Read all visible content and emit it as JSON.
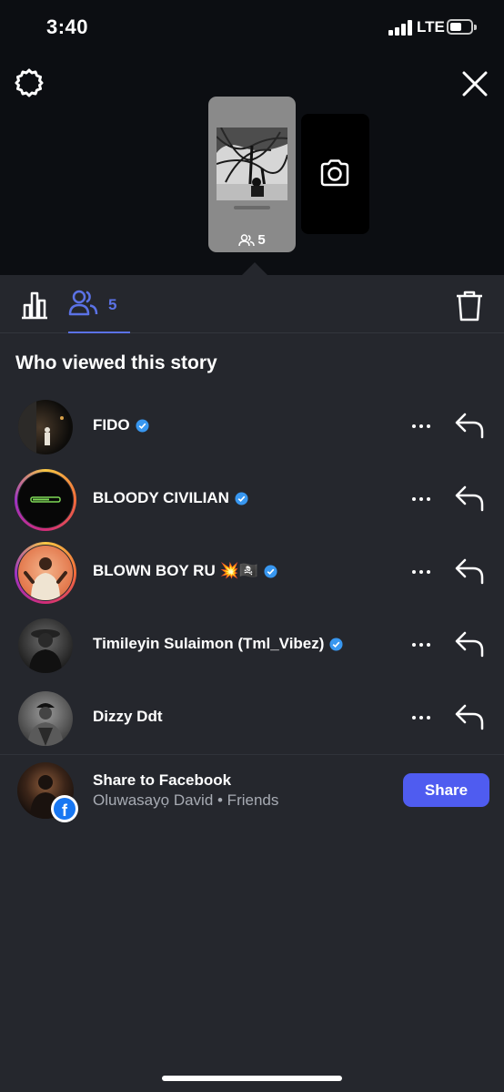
{
  "status_bar": {
    "time": "3:40",
    "network": "LTE"
  },
  "story": {
    "view_count": "5"
  },
  "tabs": {
    "viewers_count": "5"
  },
  "section_title": "Who viewed this story",
  "viewers": [
    {
      "name": "FIDO",
      "verified": true,
      "story_ring": false
    },
    {
      "name": "BLOODY CIVILIAN",
      "verified": true,
      "story_ring": true
    },
    {
      "name": "BLOWN BOY RU 💥🏴‍☠️",
      "verified": true,
      "story_ring": true
    },
    {
      "name": "Timileyin Sulaimon (Tml_Vibez)",
      "verified": true,
      "story_ring": false
    },
    {
      "name": "Dizzy Ddt",
      "verified": false,
      "story_ring": false
    }
  ],
  "facebook_share": {
    "title": "Share to Facebook",
    "subtitle": "Oluwasayọ David • Friends",
    "button_label": "Share",
    "badge_letter": "f"
  },
  "colors": {
    "accent": "#5b72e6",
    "share_button": "#4f5cf0",
    "verified": "#3897f0"
  },
  "icons": [
    "settings-icon",
    "close-icon",
    "camera-icon",
    "people-icon",
    "bar-chart-icon",
    "trash-icon",
    "more-icon",
    "reply-icon",
    "verified-icon",
    "facebook-icon"
  ]
}
